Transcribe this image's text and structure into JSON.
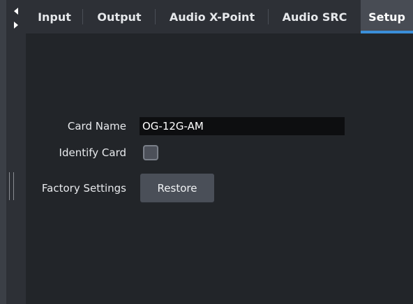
{
  "tabs": [
    {
      "label": "Input"
    },
    {
      "label": "Output"
    },
    {
      "label": "Audio X-Point"
    },
    {
      "label": "Audio SRC"
    },
    {
      "label": "Setup"
    }
  ],
  "active_tab": "Setup",
  "setup": {
    "card_name_label": "Card Name",
    "card_name_value": "OG-12G-AM",
    "identify_card_label": "Identify Card",
    "identify_card_checked": false,
    "factory_settings_label": "Factory Settings",
    "restore_button_label": "Restore"
  },
  "colors": {
    "background": "#222529",
    "tab_bar": "#2d3036",
    "active_tab": "#484c54",
    "active_indicator": "#3b8fd9",
    "input_field": "#0d0e10",
    "button": "#4a4f58"
  },
  "icons": {
    "scroll_left": "triangle-left-icon",
    "scroll_right": "triangle-right-icon",
    "grip": "vertical-grip-icon"
  }
}
